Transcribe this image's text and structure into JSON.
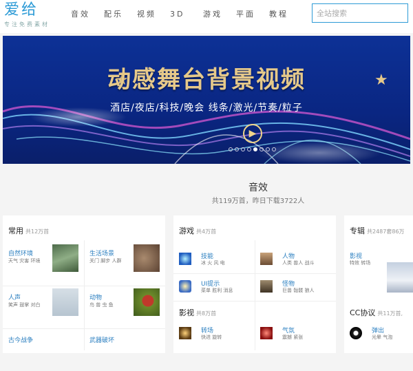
{
  "header": {
    "logo": "爱给",
    "slogan": "专注免费素材",
    "nav": [
      "音效",
      "配乐",
      "视频",
      "3D",
      "游戏",
      "平面",
      "教程"
    ],
    "search_placeholder": "全站搜索"
  },
  "banner": {
    "title": "动感舞台背景视频",
    "subtitle": "酒店/夜店/科技/晚会  线条/激光/节奏/粒子",
    "slide_count": 8,
    "active_slide": 5
  },
  "section": {
    "title": "音效",
    "subtitle": "共119万首，昨日下载3722人"
  },
  "cards": {
    "common": {
      "name": "常用",
      "count": "共12万首",
      "items": [
        {
          "name": "自然环境",
          "tags": "天气 灾害 环境"
        },
        {
          "name": "生活场景",
          "tags": "关门 脚步 人群"
        },
        {
          "name": "人声",
          "tags": "笑声 鼓掌 对白"
        },
        {
          "name": "动物",
          "tags": "鸟 兽 虫 鱼"
        },
        {
          "name": "古今战争",
          "tags": ""
        },
        {
          "name": "武器破坏",
          "tags": ""
        }
      ]
    },
    "game": {
      "name": "游戏",
      "count": "共4万首",
      "items": [
        {
          "name": "技能",
          "tags": "冰 火 风 电"
        },
        {
          "name": "人物",
          "tags": "人类 兽人 战斗"
        },
        {
          "name": "UI提示",
          "tags": "菜单 胜利 消息"
        },
        {
          "name": "怪物",
          "tags": "巨兽 骷髅 狼人"
        }
      ]
    },
    "film": {
      "name": "影视",
      "count": "共8万首",
      "items": [
        {
          "name": "转场",
          "tags": "快进 旋转"
        },
        {
          "name": "气氛",
          "tags": "震撼 紧张"
        }
      ]
    },
    "album": {
      "name": "专辑",
      "count": "共2487套86万",
      "items": [
        {
          "name": "影视",
          "tags": "特效 转场"
        }
      ]
    },
    "cc": {
      "name": "CC协议",
      "count": "共11万首,",
      "items": [
        {
          "name": "弹出",
          "tags": "光晕 气泡"
        }
      ]
    }
  },
  "colors": {
    "brand": "#2b9ad6",
    "link": "#2b7fc0",
    "banner_bg": "#0a2a86",
    "banner_title": "#e6c98a"
  }
}
